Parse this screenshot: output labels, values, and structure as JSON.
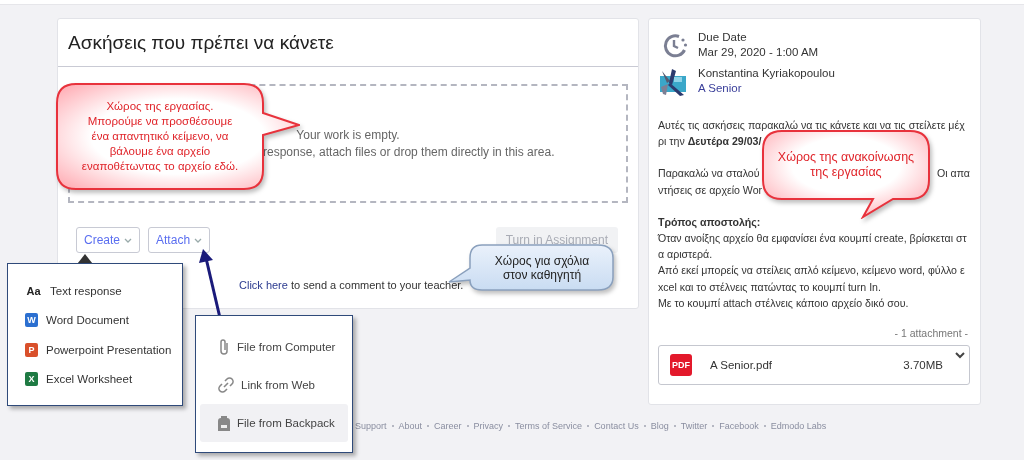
{
  "assignment": {
    "title": "Ασκήσεις που πρέπει να κάνετε",
    "dropzone": {
      "lines": [
        "Your work is empty.",
        "response, attach files or drop them directly in this area."
      ]
    },
    "buttons": [
      {
        "label": "Create",
        "kind": "dropdown"
      },
      {
        "label": "Attach",
        "kind": "dropdown"
      }
    ],
    "turn_in": {
      "label": "Turn in Assignment",
      "disabled": true
    },
    "comment": {
      "link": "Click here",
      "text": " to send a comment to your teacher."
    }
  },
  "details": {
    "due_label": "Due Date",
    "due_date": "Mar 29, 2020 - 1:00 AM",
    "author": "Konstantina Kyriakopoulou",
    "group": "A Senior",
    "lines": [
      {
        "kind": "text",
        "left": "Αυτές τις ασκήσεις παρακαλώ να τις κάνετε και να τις στείλετε μέχ"
      },
      {
        "kind": "text",
        "left": "ρι την **Δευτέρα 29/03/**"
      },
      {
        "kind": "gap"
      },
      {
        "kind": "text",
        "left": "Παρακαλώ να σταλού",
        "right": "Οι απα"
      },
      {
        "kind": "text",
        "left": "ντήσεις σε αρχείο Wor"
      },
      {
        "kind": "gap"
      },
      {
        "kind": "heading",
        "left": "Τρόπος αποστολής:"
      },
      {
        "kind": "text",
        "left": "Όταν ανοίξης αρχείο θα εμφανίσει ένα κουμπί create, βρίσκεται στ"
      },
      {
        "kind": "text",
        "left": "α αριστερά."
      },
      {
        "kind": "text",
        "left": "Από εκεί μπορείς να στείλεις απλό κείμενο, κείμενο word, φύλλο ε"
      },
      {
        "kind": "text",
        "left": "xcel και το στέλνεις πατώντας το κουμπί turn In."
      },
      {
        "kind": "text",
        "left": "Με το κουμπί attach στέλνεις κάποιο αρχείο δικό σου."
      }
    ],
    "attachment_count": "- 1 attachment  -",
    "attachment": {
      "glyph": "PDF",
      "name": "A Senior.pdf",
      "size": "3.70MB"
    }
  },
  "footer": [
    "Support",
    "About",
    "Career",
    "Privacy",
    "Terms of Service",
    "Contact Us",
    "Blog",
    "Twitter",
    "Facebook",
    "Edmodo Labs"
  ],
  "create_menu": [
    {
      "kind": "text",
      "glyph": "Aa",
      "label": "Text response"
    },
    {
      "kind": "word",
      "glyph": "W",
      "label": "Word Document"
    },
    {
      "kind": "powerpoint",
      "glyph": "P",
      "label": "Powerpoint Presentation"
    },
    {
      "kind": "excel",
      "glyph": "X",
      "label": "Excel Worksheet"
    }
  ],
  "attach_menu": [
    {
      "kind": "computer",
      "label": "File from Computer",
      "highlighted": false
    },
    {
      "kind": "web",
      "label": "Link from Web",
      "highlighted": false
    },
    {
      "kind": "backpack",
      "label": "File from Backpack",
      "highlighted": true
    }
  ],
  "callouts": [
    {
      "kind": "work",
      "lines": [
        "Χώρος της εργασίας.",
        "Μπορούμε να προσθέσουμε",
        "ένα απαντητικό κείμενο, να",
        "βάλουμε ένα αρχείο",
        "εναποθέτωντας το αρχείο εδώ."
      ]
    },
    {
      "kind": "announcement",
      "lines": [
        "Χώρος της ανακοίνωσης",
        "της εργασίας"
      ]
    },
    {
      "kind": "comment",
      "lines": [
        "Χώρος για σχόλια",
        "στον καθηγητή"
      ]
    }
  ]
}
